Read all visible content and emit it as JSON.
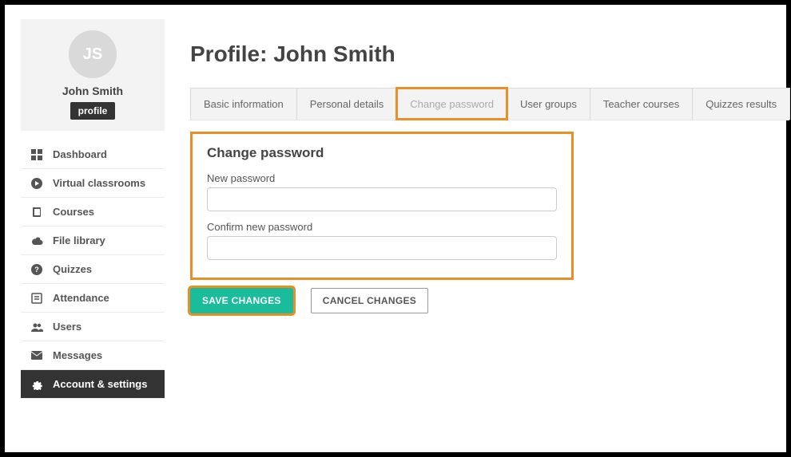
{
  "profile": {
    "initials": "JS",
    "name": "John Smith",
    "badge": "profile"
  },
  "sidebar": {
    "items": [
      {
        "label": "Dashboard"
      },
      {
        "label": "Virtual classrooms"
      },
      {
        "label": "Courses"
      },
      {
        "label": "File library"
      },
      {
        "label": "Quizzes"
      },
      {
        "label": "Attendance"
      },
      {
        "label": "Users"
      },
      {
        "label": "Messages"
      },
      {
        "label": "Account & settings"
      }
    ]
  },
  "page": {
    "title": "Profile: John Smith"
  },
  "tabs": [
    {
      "label": "Basic information"
    },
    {
      "label": "Personal details"
    },
    {
      "label": "Change password"
    },
    {
      "label": "User groups"
    },
    {
      "label": "Teacher courses"
    },
    {
      "label": "Quizzes results"
    }
  ],
  "form": {
    "heading": "Change password",
    "new_password_label": "New password",
    "new_password_value": "",
    "confirm_password_label": "Confirm new password",
    "confirm_password_value": ""
  },
  "buttons": {
    "save": "SAVE CHANGES",
    "cancel": "CANCEL CHANGES"
  }
}
